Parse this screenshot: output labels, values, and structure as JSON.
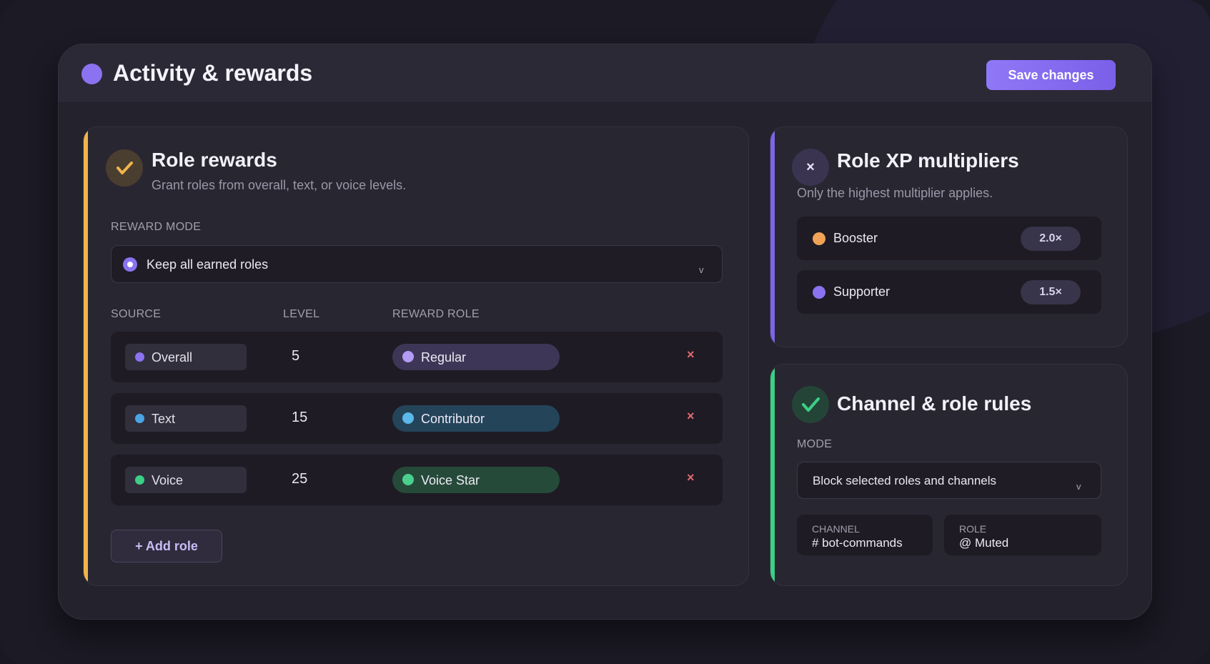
{
  "header": {
    "title": "Activity & rewards",
    "save_label": "Save changes"
  },
  "role_rewards": {
    "title": "Role rewards",
    "subtitle": "Grant roles from overall, text, or voice levels.",
    "mode_label": "REWARD MODE",
    "mode_value": "Keep all earned roles",
    "columns": [
      "SOURCE",
      "LEVEL",
      "REWARD ROLE"
    ],
    "rows": [
      {
        "source": "Overall",
        "level": "5",
        "role": "Regular",
        "remove": "×"
      },
      {
        "source": "Text",
        "level": "15",
        "role": "Contributor",
        "remove": "×"
      },
      {
        "source": "Voice",
        "level": "25",
        "role": "Voice Star",
        "remove": "×"
      }
    ],
    "add_label": "+ Add role",
    "accent": "#f1b44c"
  },
  "xp_multipliers": {
    "title": "Role XP multipliers",
    "subtitle": "Only the highest multiplier applies.",
    "items": [
      {
        "name": "Booster",
        "value": "2.0×",
        "color": "#f0a257"
      },
      {
        "name": "Supporter",
        "value": "1.5×",
        "color": "#8b72f0"
      }
    ],
    "close_glyph": "×",
    "accent": "#7d65e6"
  },
  "channel_rules": {
    "title": "Channel & role rules",
    "mode_label": "MODE",
    "mode_value": "Block selected roles and channels",
    "channel_label": "CHANNEL",
    "channel_value": "# bot-commands",
    "role_label": "ROLE",
    "role_value": "@ Muted",
    "accent": "#3ccf86"
  },
  "select_chevron": "v"
}
